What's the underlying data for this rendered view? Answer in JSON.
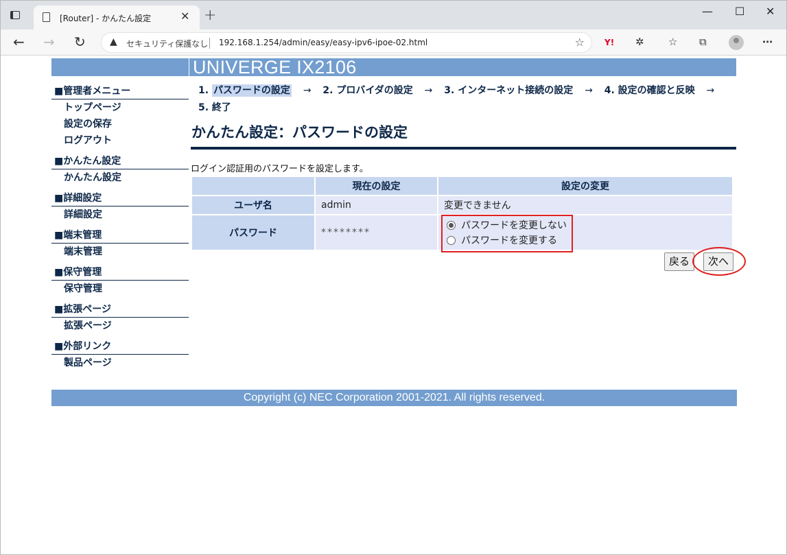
{
  "browser": {
    "tab_title": "[Router] - かんたん設定",
    "security_label": "セキュリティ保護なし",
    "url": "192.168.1.254/admin/easy/easy-ipv6-ipoe-02.html"
  },
  "header": {
    "product": "UNIVERGE IX2106"
  },
  "sidebar": {
    "sections": [
      {
        "head": "■管理者メニュー",
        "links": [
          "トップページ",
          "設定の保存",
          "ログアウト"
        ]
      },
      {
        "head": "■かんたん設定",
        "links": [
          "かんたん設定"
        ]
      },
      {
        "head": "■詳細設定",
        "links": [
          "詳細設定"
        ]
      },
      {
        "head": "■端末管理",
        "links": [
          "端末管理"
        ]
      },
      {
        "head": "■保守管理",
        "links": [
          "保守管理"
        ]
      },
      {
        "head": "■拡張ページ",
        "links": [
          "拡張ページ"
        ]
      },
      {
        "head": "■外部リンク",
        "links": [
          "製品ページ"
        ]
      }
    ]
  },
  "steps": {
    "s1_num": "1.",
    "s1": "パスワードの設定",
    "s2": "2. プロバイダの設定",
    "s3": "3. インターネット接続の設定",
    "s4": "4. 設定の確認と反映",
    "s5": "5. 終了",
    "arrow": "→"
  },
  "main": {
    "title": "かんたん設定：パスワードの設定",
    "intro": "ログイン認証用のパスワードを設定します。",
    "table": {
      "col_current": "現在の設定",
      "col_change": "設定の変更",
      "row_user": "ユーザ名",
      "user_current": "admin",
      "user_change": "変更できません",
      "row_password": "パスワード",
      "password_current": "********",
      "options": [
        {
          "label": "パスワードを変更しない",
          "checked": true
        },
        {
          "label": "パスワードを変更する",
          "checked": false
        }
      ]
    },
    "back_button": "戻る",
    "next_button": "次へ"
  },
  "footer": {
    "copyright": "Copyright (c) NEC Corporation 2001-2021. All rights reserved."
  }
}
